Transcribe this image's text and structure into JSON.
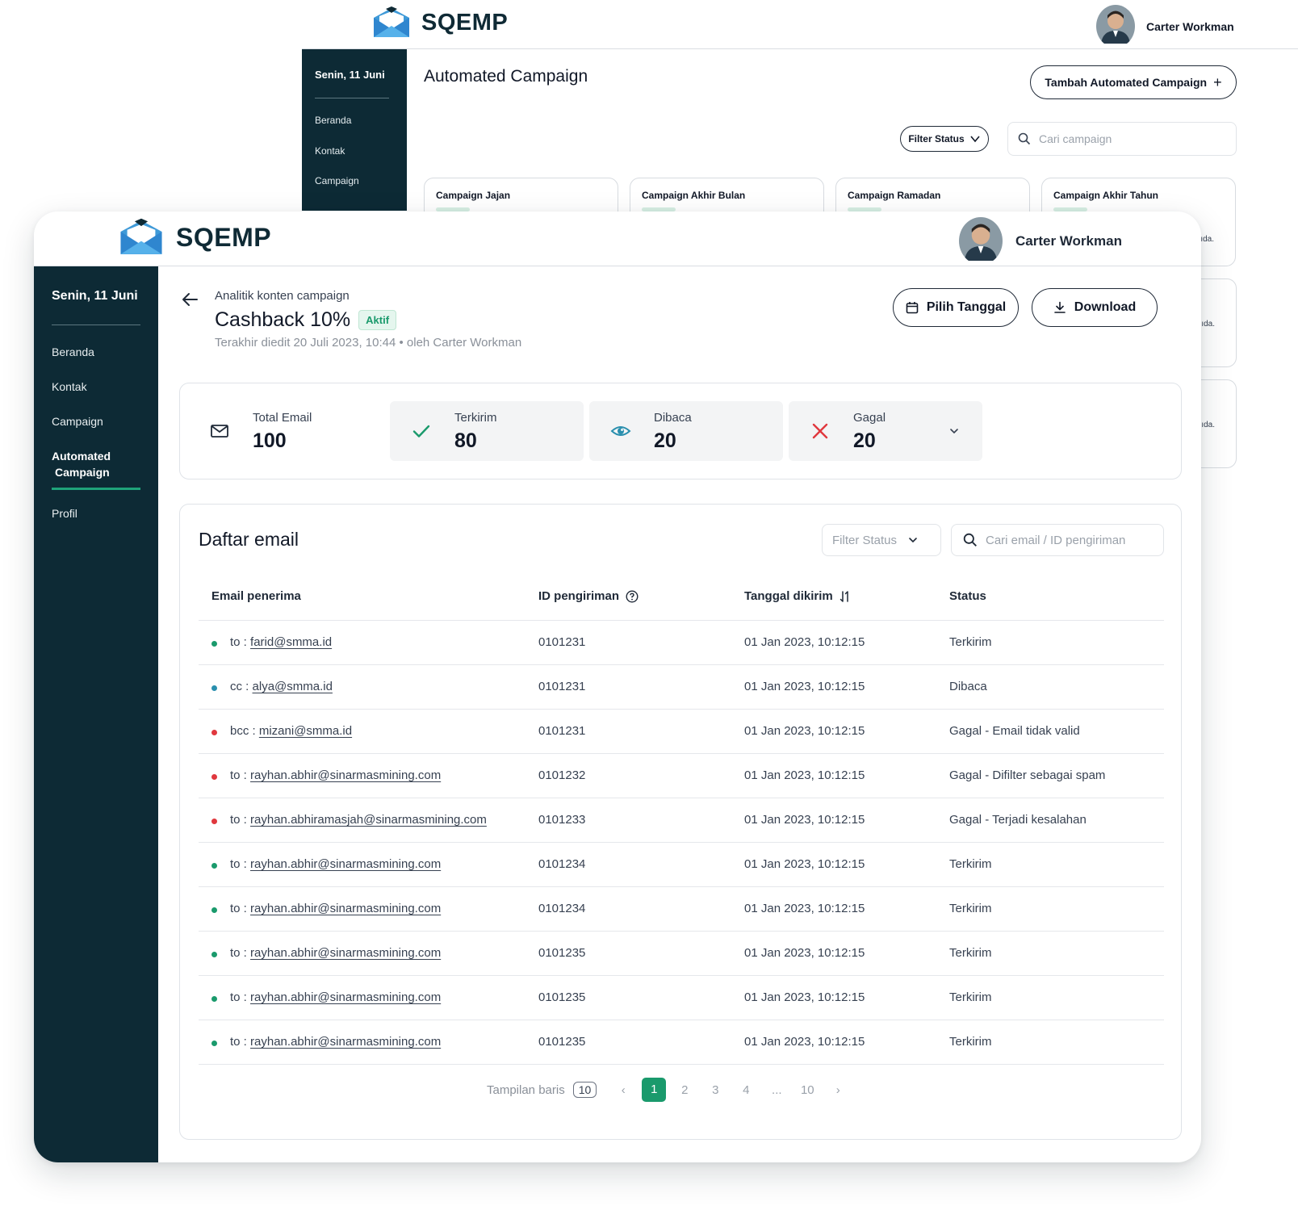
{
  "background_window": {
    "brand": "SQEMP",
    "user_name": "Carter Workman",
    "sidebar": {
      "date": "Senin, 11 Juni",
      "items": [
        "Beranda",
        "Kontak",
        "Campaign"
      ]
    },
    "page_title": "Automated Campaign",
    "add_button": "Tambah Automated Campaign",
    "filter_label": "Filter Status",
    "search_placeholder": "Cari campaign",
    "cards": [
      "Campaign Jajan",
      "Campaign Akhir Bulan",
      "Campaign Ramadan",
      "Campaign Akhir Tahun"
    ],
    "side_card_text": "ıda."
  },
  "app": {
    "brand": "SQEMP",
    "user_name": "Carter Workman"
  },
  "sidebar": {
    "date": "Senin, 11 Juni",
    "items": [
      {
        "label": "Beranda"
      },
      {
        "label": "Kontak"
      },
      {
        "label": "Campaign"
      },
      {
        "label": "Automated  Campaign",
        "label_line1": "Automated",
        "label_line2": "Campaign",
        "active": true
      },
      {
        "label": "Profil"
      }
    ]
  },
  "header": {
    "breadcrumb": "Analitik konten campaign",
    "title": "Cashback 10%",
    "status_badge": "Aktif",
    "meta": "Terakhir diedit 20 Juli 2023, 10:44 • oleh Carter Workman",
    "date_button": "Pilih Tanggal",
    "download_button": "Download"
  },
  "stats": [
    {
      "label": "Total Email",
      "value": "100",
      "icon": "mail-icon"
    },
    {
      "label": "Terkirim",
      "value": "80",
      "icon": "check-icon"
    },
    {
      "label": "Dibaca",
      "value": "20",
      "icon": "eye-icon"
    },
    {
      "label": "Gagal",
      "value": "20",
      "icon": "x-icon"
    }
  ],
  "email_list": {
    "title": "Daftar email",
    "filter_placeholder": "Filter Status",
    "search_placeholder": "Cari email / ID pengiriman",
    "columns": [
      "Email penerima",
      "ID pengiriman",
      "Tanggal dikirim",
      "Status"
    ],
    "rows": [
      {
        "prefix": "to :",
        "email": "farid@smma.id",
        "id": "0101231",
        "date": "01 Jan 2023, 10:12:15",
        "status": "Terkirim",
        "dot": "#1a9a6c"
      },
      {
        "prefix": "cc :",
        "email": "alya@smma.id",
        "id": "0101231",
        "date": "01 Jan 2023, 10:12:15",
        "status": "Dibaca",
        "dot": "#2a8fae"
      },
      {
        "prefix": "bcc :",
        "email": "mizani@smma.id",
        "id": "0101231",
        "date": "01 Jan 2023, 10:12:15",
        "status": "Gagal - Email tidak valid",
        "dot": "#e0383e"
      },
      {
        "prefix": "to :",
        "email": "rayhan.abhir@sinarmasmining.com",
        "id": "0101232",
        "date": "01 Jan 2023, 10:12:15",
        "status": "Gagal - Difilter sebagai spam",
        "dot": "#e0383e"
      },
      {
        "prefix": "to :",
        "email": "rayhan.abhiramasjah@sinarmasmining.com",
        "id": "0101233",
        "date": "01 Jan 2023, 10:12:15",
        "status": "Gagal - Terjadi kesalahan",
        "dot": "#e0383e"
      },
      {
        "prefix": "to :",
        "email": "rayhan.abhir@sinarmasmining.com",
        "id": "0101234",
        "date": "01 Jan 2023, 10:12:15",
        "status": "Terkirim",
        "dot": "#1a9a6c"
      },
      {
        "prefix": "to :",
        "email": "rayhan.abhir@sinarmasmining.com",
        "id": "0101234",
        "date": "01 Jan 2023, 10:12:15",
        "status": "Terkirim",
        "dot": "#1a9a6c"
      },
      {
        "prefix": "to :",
        "email": "rayhan.abhir@sinarmasmining.com",
        "id": "0101235",
        "date": "01 Jan 2023, 10:12:15",
        "status": "Terkirim",
        "dot": "#1a9a6c"
      },
      {
        "prefix": "to :",
        "email": "rayhan.abhir@sinarmasmining.com",
        "id": "0101235",
        "date": "01 Jan 2023, 10:12:15",
        "status": "Terkirim",
        "dot": "#1a9a6c"
      },
      {
        "prefix": "to :",
        "email": "rayhan.abhir@sinarmasmining.com",
        "id": "0101235",
        "date": "01 Jan 2023, 10:12:15",
        "status": "Terkirim",
        "dot": "#1a9a6c"
      }
    ]
  },
  "pagination": {
    "rows_label": "Tampilan baris",
    "rows_value": "10",
    "prev": "‹",
    "next": "›",
    "pages": [
      "1",
      "2",
      "3",
      "4",
      "...",
      "10"
    ],
    "current": "1"
  },
  "colors": {
    "sidebar": "#0d2a35",
    "accent": "#1a9a6c",
    "success": "#1a9a6c",
    "info": "#2a8fae",
    "danger": "#e0383e"
  }
}
